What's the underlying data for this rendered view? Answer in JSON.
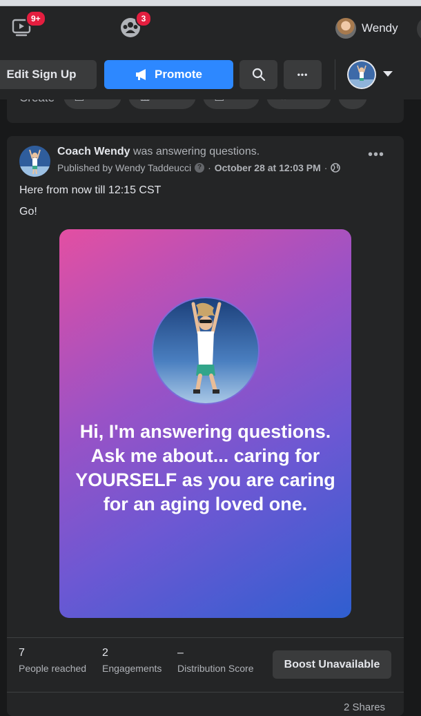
{
  "nav": {
    "watch_badge": "9+",
    "groups_badge": "3",
    "profile_name": "Wendy"
  },
  "toolbar": {
    "edit_signup_label": "Edit Sign Up",
    "promote_label": "Promote",
    "more_label": "•••"
  },
  "create": {
    "label": "Create",
    "chips": [
      "Live",
      "Event",
      "Job",
      "Offer"
    ]
  },
  "post": {
    "author": "Coach Wendy",
    "action": "was answering questions.",
    "published_by": "Published by Wendy Taddeucci",
    "date": "October 28 at 12:03 PM",
    "more_label": "•••",
    "text_line1": "Here from now till 12:15 CST",
    "text_line2": "Go!",
    "card_text": "Hi, I'm answering questions. Ask me about... caring for YOURSELF as you are caring for an aging loved one."
  },
  "insights": {
    "people_reached_value": "7",
    "people_reached_label": "People reached",
    "engagements_value": "2",
    "engagements_label": "Engagements",
    "distribution_value": "–",
    "distribution_label": "Distribution Score",
    "boost_label": "Boost Unavailable"
  },
  "footer": {
    "shares": "2 Shares"
  },
  "colors": {
    "background": "#18191a",
    "card": "#242526",
    "accent_blue": "#2d88ff",
    "badge_red": "#e41e3f"
  }
}
